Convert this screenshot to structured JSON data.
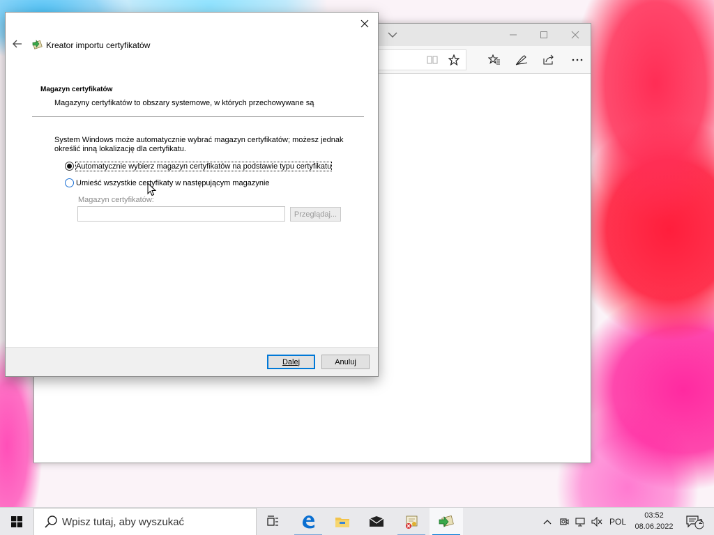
{
  "wizard": {
    "title": "Kreator importu certyfikatów",
    "section_title": "Magazyn certyfikatów",
    "section_description": "Magazyny certyfikatów to obszary systemowe, w których przechowywane są",
    "intro_line1": "System Windows może automatycznie wybrać magazyn certyfikatów; możesz jednak",
    "intro_line2": "określić inną lokalizację dla certyfikatu.",
    "options": [
      {
        "label": "Automatycznie wybierz magazyn certyfikatów na podstawie typu certyfikatu",
        "selected": true
      },
      {
        "label": "Umieść wszystkie certyfikaty w następującym magazynie",
        "selected": false
      }
    ],
    "store_label": "Magazyn certyfikatów:",
    "store_value": "",
    "browse_label": "Przeglądaj...",
    "next_label": "Dalej",
    "cancel_label": "Anuluj"
  },
  "browser": {
    "icons": [
      "chevron-down-icon",
      "minimize-icon",
      "maximize-icon",
      "close-icon",
      "reading-view-icon",
      "favorite-star-icon",
      "favorites-hub-icon",
      "pen-icon",
      "share-icon",
      "more-icon"
    ]
  },
  "taskbar": {
    "search_placeholder": "Wpisz tutaj, aby wyszukać",
    "language": "POL",
    "time": "03:52",
    "date": "08.06.2022",
    "notification_count": "2",
    "apps": [
      "task-view-icon",
      "edge-icon",
      "file-explorer-icon",
      "mail-icon",
      "certificate-manager-icon",
      "certificate-import-icon"
    ]
  },
  "colors": {
    "accent": "#0078d7",
    "taskbar_bg": "#e9e9ec",
    "dialog_footer": "#f0f0f0"
  }
}
